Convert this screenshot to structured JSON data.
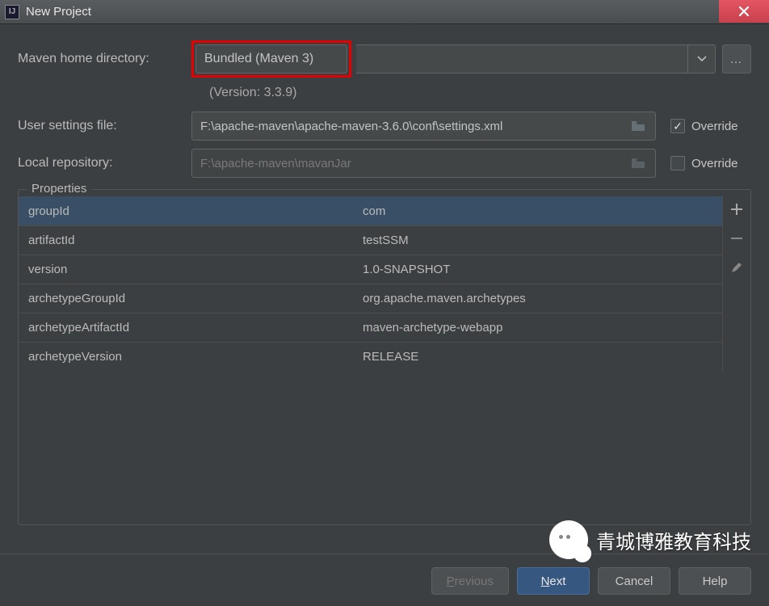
{
  "window": {
    "title": "New Project"
  },
  "fields": {
    "mavenHome": {
      "label": "Maven home directory:",
      "value": "Bundled (Maven 3)",
      "version": "(Version: 3.3.9)"
    },
    "userSettings": {
      "label": "User settings file:",
      "value": "F:\\apache-maven\\apache-maven-3.6.0\\conf\\settings.xml",
      "override": "Override",
      "overrideChecked": true
    },
    "localRepo": {
      "label": "Local repository:",
      "value": "F:\\apache-maven\\mavanJar",
      "override": "Override",
      "overrideChecked": false
    }
  },
  "properties": {
    "legend": "Properties",
    "rows": [
      {
        "key": "groupId",
        "value": "com",
        "selected": true
      },
      {
        "key": "artifactId",
        "value": "testSSM"
      },
      {
        "key": "version",
        "value": "1.0-SNAPSHOT"
      },
      {
        "key": "archetypeGroupId",
        "value": "org.apache.maven.archetypes"
      },
      {
        "key": "archetypeArtifactId",
        "value": "maven-archetype-webapp"
      },
      {
        "key": "archetypeVersion",
        "value": "RELEASE"
      }
    ]
  },
  "buttons": {
    "previous": "Previous",
    "next": "Next",
    "cancel": "Cancel",
    "help": "Help"
  },
  "watermark": "青城博雅教育科技"
}
